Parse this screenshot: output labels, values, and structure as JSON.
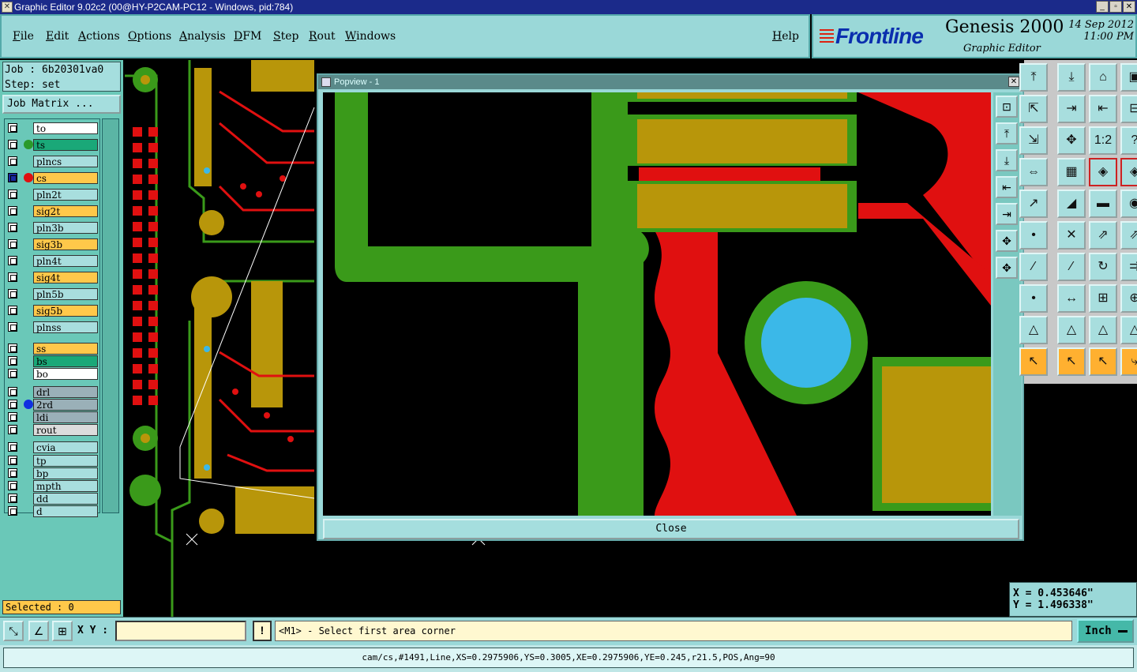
{
  "window": {
    "title": "Graphic Editor 9.02c2 (00@HY-P2CAM-PC12 - Windows, pid:784)",
    "buttons": [
      "_",
      "▫",
      "✕"
    ]
  },
  "menu": [
    "File",
    "Edit",
    "Actions",
    "Options",
    "Analysis",
    "DFM",
    "Step",
    "Rout",
    "Windows"
  ],
  "help": "Help",
  "brand": {
    "logo": "Frontline",
    "product": "Genesis 2000",
    "subtitle": "Graphic Editor",
    "date": "14 Sep 2012",
    "time": "11:00 PM"
  },
  "job": {
    "job_line": "Job : 6b20301va0",
    "step_line": "Step: set",
    "matrix_button": "Job Matrix ..."
  },
  "layers": [
    {
      "name": "to",
      "color": "#ffffff",
      "dot": ""
    },
    {
      "name": "ts",
      "color": "#1aa878",
      "dot": "#2a9a2a"
    },
    {
      "name": "plncs",
      "color": "#a8dede",
      "dot": ""
    },
    {
      "name": "cs",
      "color": "#ffc84a",
      "dot": "#e01010",
      "active": true
    },
    {
      "name": "pln2t",
      "color": "#a8dede",
      "dot": ""
    },
    {
      "name": "sig2t",
      "color": "#ffc84a",
      "dot": ""
    },
    {
      "name": "pln3b",
      "color": "#a8dede",
      "dot": ""
    },
    {
      "name": "sig3b",
      "color": "#ffc84a",
      "dot": ""
    },
    {
      "name": "pln4t",
      "color": "#a8dede",
      "dot": ""
    },
    {
      "name": "sig4t",
      "color": "#ffc84a",
      "dot": ""
    },
    {
      "name": "pln5b",
      "color": "#a8dede",
      "dot": ""
    },
    {
      "name": "sig5b",
      "color": "#ffc84a",
      "dot": ""
    },
    {
      "name": "plnss",
      "color": "#a8dede",
      "dot": ""
    },
    {
      "name": "ss",
      "color": "#ffc84a",
      "dot": ""
    },
    {
      "name": "bs",
      "color": "#1aa878",
      "dot": ""
    },
    {
      "name": "bo",
      "color": "#ffffff",
      "dot": ""
    },
    {
      "name": "drl",
      "color": "#9ab0b8",
      "dot": ""
    },
    {
      "name": "2rd",
      "color": "#9ab0b8",
      "dot": "#1030e0"
    },
    {
      "name": "ldi",
      "color": "#9ab0b8",
      "dot": ""
    },
    {
      "name": "rout",
      "color": "#dcdcdc",
      "dot": ""
    },
    {
      "name": "cvia",
      "color": "#a8dede",
      "dot": ""
    },
    {
      "name": "tp",
      "color": "#a8dede",
      "dot": ""
    },
    {
      "name": "bp",
      "color": "#a8dede",
      "dot": ""
    },
    {
      "name": "mpth",
      "color": "#a8dede",
      "dot": ""
    },
    {
      "name": "dd",
      "color": "#a8dede",
      "dot": ""
    },
    {
      "name": "d",
      "color": "#a8dede",
      "dot": ""
    }
  ],
  "selected": "Selected : 0",
  "popview": {
    "title": "Popview - 1",
    "close_button": "Close"
  },
  "coords": {
    "x": "X = 0.453646\"",
    "y": "Y = 1.496338\""
  },
  "input": {
    "xy_label": "X Y :",
    "xy_value": "",
    "excl": "!",
    "prompt": "<M1> - Select first area corner",
    "unit": "Inch"
  },
  "status": "cam/cs,#1491,Line,XS=0.2975906,YS=0.3005,XE=0.2975906,YE=0.245,r21.5,POS,Ang=90",
  "tools": [
    "⤒",
    "⤓",
    "⌂",
    "▣",
    "⇱",
    "⇥",
    "⇤",
    "⊟",
    "⇲",
    "✥",
    "1:2",
    "?",
    "⇔",
    "▦",
    "◈",
    "◈",
    "↗",
    "◢",
    "▬",
    "◉",
    "•",
    "✕",
    "⇗",
    "⇗",
    "∕",
    "∕",
    "↻",
    "⇉",
    "•",
    "↔",
    "⊞",
    "⊕",
    "△",
    "△",
    "△",
    "△",
    "↖",
    "↖",
    "↖",
    "⤷"
  ]
}
